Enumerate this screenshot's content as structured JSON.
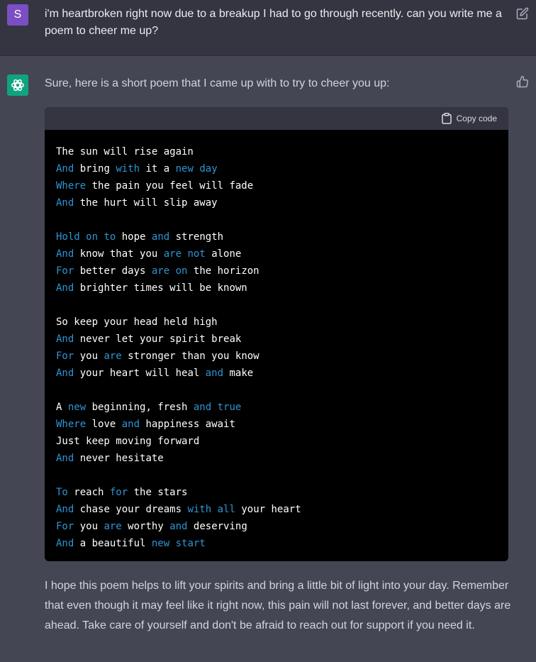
{
  "user_message": {
    "avatar_letter": "S",
    "text": "i'm heartbroken right now due to a breakup I had to go through recently. can you write me a poem to cheer me up?",
    "icon": "edit-icon"
  },
  "assistant_message": {
    "intro": "Sure, here is a short poem that I came up with to try to cheer you up:",
    "icon": "thumbs-up-icon",
    "code_block": {
      "copy_label": "Copy code",
      "keyword_color": "#2e95d3",
      "lines": [
        [
          [
            "t",
            "The sun will rise again"
          ]
        ],
        [
          [
            "k",
            "And"
          ],
          [
            "t",
            " bring "
          ],
          [
            "k",
            "with"
          ],
          [
            "t",
            " it a "
          ],
          [
            "k",
            "new"
          ],
          [
            "t",
            " "
          ],
          [
            "k",
            "day"
          ]
        ],
        [
          [
            "k",
            "Where"
          ],
          [
            "t",
            " the pain you feel will fade"
          ]
        ],
        [
          [
            "k",
            "And"
          ],
          [
            "t",
            " the hurt will slip away"
          ]
        ],
        [],
        [
          [
            "k",
            "Hold"
          ],
          [
            "t",
            " "
          ],
          [
            "k",
            "on"
          ],
          [
            "t",
            " "
          ],
          [
            "k",
            "to"
          ],
          [
            "t",
            " hope "
          ],
          [
            "k",
            "and"
          ],
          [
            "t",
            " strength"
          ]
        ],
        [
          [
            "k",
            "And"
          ],
          [
            "t",
            " know that you "
          ],
          [
            "k",
            "are"
          ],
          [
            "t",
            " "
          ],
          [
            "k",
            "not"
          ],
          [
            "t",
            " alone"
          ]
        ],
        [
          [
            "k",
            "For"
          ],
          [
            "t",
            " better days "
          ],
          [
            "k",
            "are"
          ],
          [
            "t",
            " "
          ],
          [
            "k",
            "on"
          ],
          [
            "t",
            " the horizon"
          ]
        ],
        [
          [
            "k",
            "And"
          ],
          [
            "t",
            " brighter times will be known"
          ]
        ],
        [],
        [
          [
            "t",
            "So keep your head held high"
          ]
        ],
        [
          [
            "k",
            "And"
          ],
          [
            "t",
            " never let your spirit break"
          ]
        ],
        [
          [
            "k",
            "For"
          ],
          [
            "t",
            " you "
          ],
          [
            "k",
            "are"
          ],
          [
            "t",
            " stronger than you know"
          ]
        ],
        [
          [
            "k",
            "And"
          ],
          [
            "t",
            " your heart will heal "
          ],
          [
            "k",
            "and"
          ],
          [
            "t",
            " make"
          ]
        ],
        [],
        [
          [
            "t",
            "A "
          ],
          [
            "k",
            "new"
          ],
          [
            "t",
            " beginning, fresh "
          ],
          [
            "k",
            "and"
          ],
          [
            "t",
            " "
          ],
          [
            "k",
            "true"
          ]
        ],
        [
          [
            "k",
            "Where"
          ],
          [
            "t",
            " love "
          ],
          [
            "k",
            "and"
          ],
          [
            "t",
            " happiness await"
          ]
        ],
        [
          [
            "t",
            "Just keep moving forward"
          ]
        ],
        [
          [
            "k",
            "And"
          ],
          [
            "t",
            " never hesitate"
          ]
        ],
        [],
        [
          [
            "k",
            "To"
          ],
          [
            "t",
            " reach "
          ],
          [
            "k",
            "for"
          ],
          [
            "t",
            " the stars"
          ]
        ],
        [
          [
            "k",
            "And"
          ],
          [
            "t",
            " chase your dreams "
          ],
          [
            "k",
            "with"
          ],
          [
            "t",
            " "
          ],
          [
            "k",
            "all"
          ],
          [
            "t",
            " your heart"
          ]
        ],
        [
          [
            "k",
            "For"
          ],
          [
            "t",
            " you "
          ],
          [
            "k",
            "are"
          ],
          [
            "t",
            " worthy "
          ],
          [
            "k",
            "and"
          ],
          [
            "t",
            " deserving"
          ]
        ],
        [
          [
            "k",
            "And"
          ],
          [
            "t",
            " a beautiful "
          ],
          [
            "k",
            "new"
          ],
          [
            "t",
            " "
          ],
          [
            "k",
            "start"
          ]
        ]
      ]
    },
    "outro": "I hope this poem helps to lift your spirits and bring a little bit of light into your day. Remember that even though it may feel like it right now, this pain will not last forever, and better days are ahead. Take care of yourself and don't be afraid to reach out for support if you need it."
  }
}
